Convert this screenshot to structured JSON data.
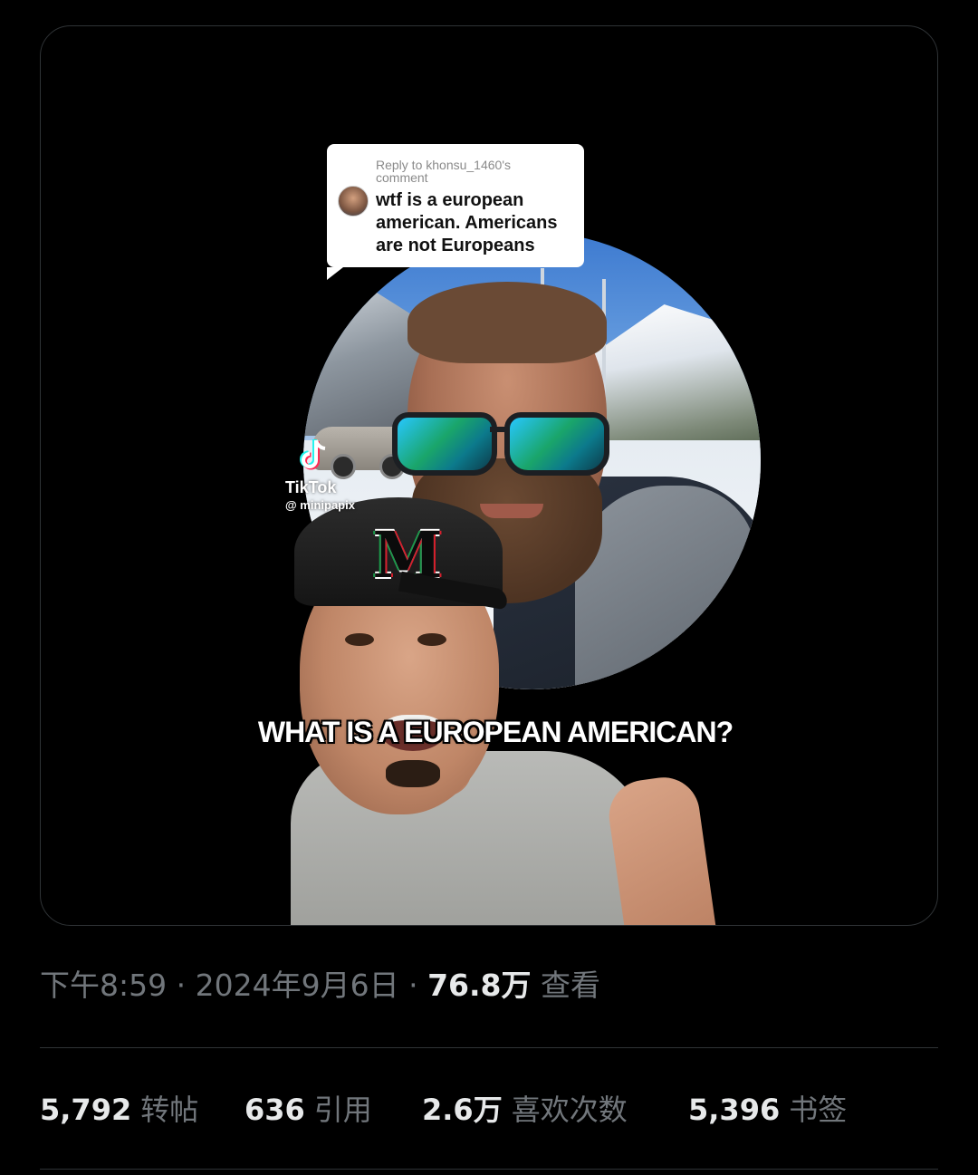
{
  "media": {
    "reply_bubble": {
      "header": "Reply to khonsu_1460's comment",
      "text": "wtf is a european american. Americans are not Europeans"
    },
    "watermark": {
      "brand": "TikTok",
      "handle": "@ minipapix"
    },
    "caption": "WHAT IS A EUROPEAN AMERICAN?",
    "cap_logo": "M"
  },
  "meta": {
    "time": "下午8:59",
    "separator": " · ",
    "date": "2024年9月6日",
    "views_count": "76.8万",
    "views_label": "查看"
  },
  "stats": [
    {
      "count": "5,792",
      "label": "转帖"
    },
    {
      "count": "636",
      "label": "引用"
    },
    {
      "count": "2.6万",
      "label": "喜欢次数"
    },
    {
      "count": "5,396",
      "label": "书签"
    }
  ],
  "colors": {
    "background": "#000000",
    "primary_text": "#e7e9ea",
    "secondary_text": "#71767b",
    "divider": "#2f3336"
  }
}
